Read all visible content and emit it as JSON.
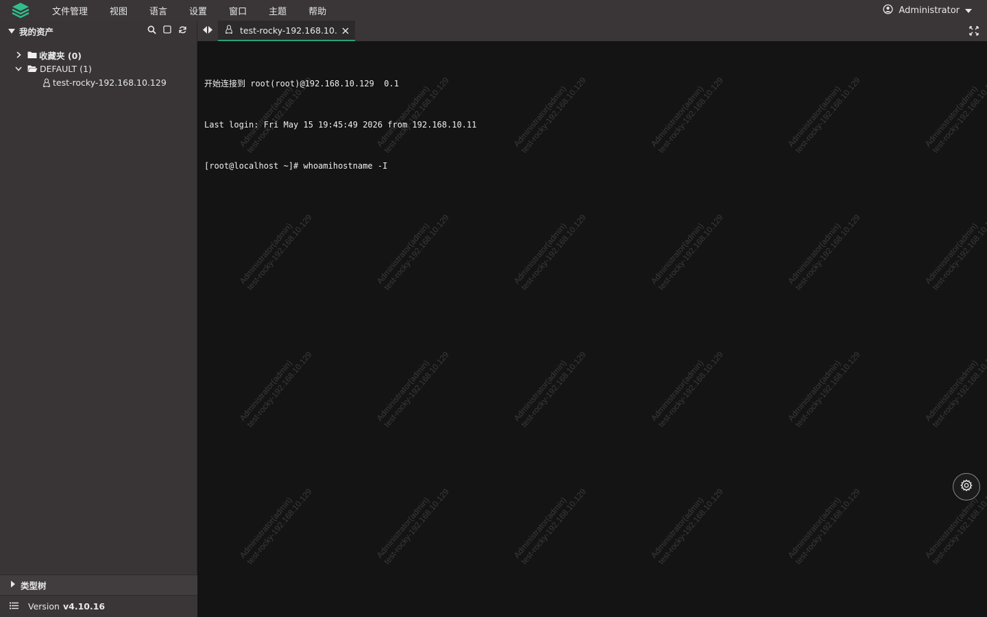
{
  "menubar": {
    "items": [
      "文件管理",
      "视图",
      "语言",
      "设置",
      "窗口",
      "主题",
      "帮助"
    ],
    "user": "Administrator"
  },
  "sidebar": {
    "title": "我的资产",
    "tree": {
      "favorites": "收藏夹 (0)",
      "default_group": "DEFAULT (1)",
      "host": "test-rocky-192.168.10.129"
    },
    "type_tree": "类型树",
    "version_label": "Version",
    "version_number": "v4.10.16"
  },
  "tabs": {
    "active_label": "test-rocky-192.168.10...."
  },
  "terminal": {
    "lines": [
      "开始连接到 root(root)@192.168.10.129  0.1",
      "Last login: Fri May 15 19:45:49 2026 from 192.168.10.11",
      "[root@localhost ~]# whoamihostname -I"
    ],
    "watermark_line1": "Administrator(admin)",
    "watermark_line2": "test-rocky-192.168.10.129"
  },
  "colors": {
    "accent": "#29a37a",
    "logo": "#2fbf8a",
    "menubar": "#3a3637",
    "terminal_bg": "#141414"
  },
  "icons": {
    "logo": "layers-logo-icon",
    "user": "user-circle-icon",
    "search": "search-icon",
    "collapse": "square-icon",
    "refresh": "refresh-icon",
    "folder": "folder-icon",
    "linux": "linux-penguin-icon",
    "close": "close-icon",
    "fullscreen": "fullscreen-icon",
    "settings": "gear-icon"
  }
}
